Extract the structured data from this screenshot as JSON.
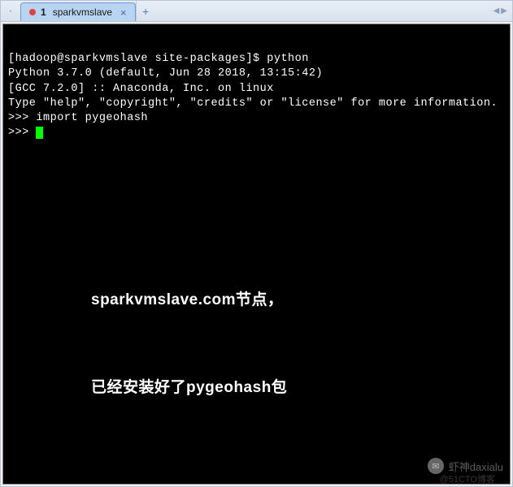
{
  "tab": {
    "index": "1",
    "title": "sparkvmslave",
    "close": "×",
    "add": "+"
  },
  "nav": {
    "left": "◀",
    "right": "▶"
  },
  "terminal": {
    "lines": [
      "[hadoop@sparkvmslave site-packages]$ python",
      "Python 3.7.0 (default, Jun 28 2018, 13:15:42)",
      "[GCC 7.2.0] :: Anaconda, Inc. on linux",
      "Type \"help\", \"copyright\", \"credits\" or \"license\" for more information.",
      ">>> import pygeohash",
      ">>> "
    ]
  },
  "annotation": {
    "line1": "sparkvmslave.com节点，",
    "line2": "已经安装好了pygeohash包"
  },
  "watermark": {
    "name": "虾神daxialu",
    "sub": "@51CTO博客"
  }
}
